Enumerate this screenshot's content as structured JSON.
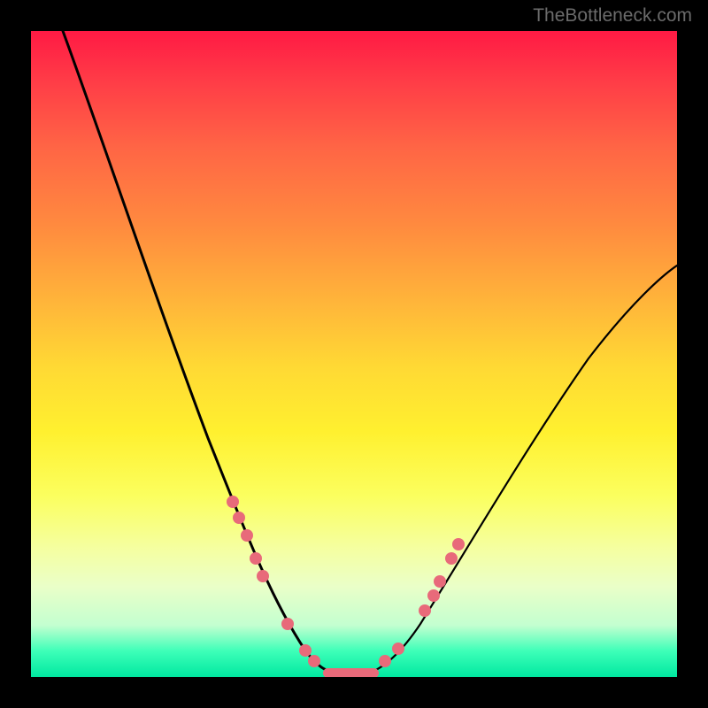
{
  "watermark": "TheBottleneck.com",
  "chart_data": {
    "type": "line",
    "title": "",
    "xlabel": "",
    "ylabel": "",
    "xlim": [
      0,
      100
    ],
    "ylim": [
      0,
      100
    ],
    "series": [
      {
        "name": "left-curve",
        "x": [
          5,
          8,
          12,
          16,
          20,
          24,
          28,
          31,
          34,
          37,
          40,
          43,
          45,
          47,
          49
        ],
        "values": [
          100,
          84,
          67,
          52,
          40,
          30,
          22,
          16,
          12,
          8,
          5,
          3,
          1,
          0,
          0
        ]
      },
      {
        "name": "right-curve",
        "x": [
          49,
          52,
          55,
          58,
          62,
          66,
          70,
          75,
          80,
          85,
          90,
          95,
          100
        ],
        "values": [
          0,
          1,
          3,
          6,
          10,
          15,
          21,
          28,
          35,
          42,
          49,
          55,
          60
        ]
      }
    ],
    "markers": {
      "left_cluster": [
        {
          "x": 31,
          "y": 19
        },
        {
          "x": 32,
          "y": 17
        },
        {
          "x": 33,
          "y": 15
        },
        {
          "x": 35,
          "y": 12
        },
        {
          "x": 36,
          "y": 10
        },
        {
          "x": 40,
          "y": 6
        },
        {
          "x": 43,
          "y": 3
        },
        {
          "x": 44,
          "y": 2
        }
      ],
      "right_cluster": [
        {
          "x": 53,
          "y": 2
        },
        {
          "x": 55,
          "y": 4
        },
        {
          "x": 60,
          "y": 9
        },
        {
          "x": 61,
          "y": 11
        },
        {
          "x": 62,
          "y": 13
        },
        {
          "x": 64,
          "y": 16
        },
        {
          "x": 65,
          "y": 18
        }
      ],
      "flat_bottom": {
        "x_start": 45,
        "x_end": 52,
        "y": 0.5
      }
    },
    "gradient_stops": [
      {
        "pos": 0,
        "color": "#ff1a44"
      },
      {
        "pos": 50,
        "color": "#ffe632"
      },
      {
        "pos": 100,
        "color": "#00e8a0"
      }
    ]
  }
}
